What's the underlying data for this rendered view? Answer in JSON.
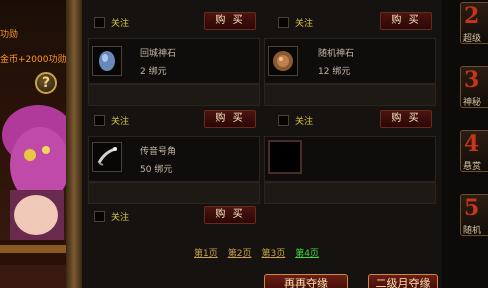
{
  "left_panel": {
    "gold_prev": "功勋",
    "gold_bonus": "金币+2000功勋",
    "help": "?"
  },
  "shop": {
    "follow_label": "关注",
    "buy_label": "购 买",
    "items": [
      {
        "name": "回城神石",
        "price": "2 绑元",
        "icon": "return-stone-icon"
      },
      {
        "name": "随机神石",
        "price": "12 绑元",
        "icon": "random-stone-icon"
      },
      {
        "name": "传音号角",
        "price": "50 绑元",
        "icon": "horn-icon"
      }
    ],
    "pager": [
      "第1页",
      "第2页",
      "第3页",
      "第4页"
    ],
    "active_page": "第4页"
  },
  "bottom_buttons": {
    "recharge_label": "再再夺缘",
    "second_recharge_label": "二级月夺缘"
  },
  "right_tabs": [
    {
      "num": "2",
      "label": "超级"
    },
    {
      "num": "3",
      "label": "神秘"
    },
    {
      "num": "4",
      "label": "悬赏"
    },
    {
      "num": "5",
      "label": "随机"
    }
  ],
  "colors": {
    "follow_text": "#d9c94a",
    "page_active": "#3fdc3f",
    "gold_text": "#ff9a1a",
    "tab_number": "#c7361a"
  }
}
